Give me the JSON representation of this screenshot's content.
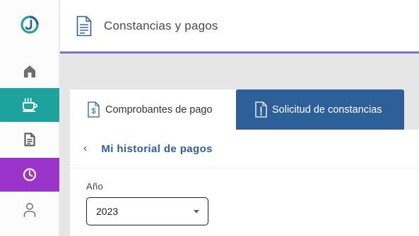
{
  "app": {
    "logo_icon": "app-logo-icon"
  },
  "colors": {
    "teal": "#1ba39c",
    "purple": "#9b35c9",
    "blue": "#2e5f99",
    "header_underline": "#7b6fd9"
  },
  "sidebar": {
    "items": [
      {
        "name": "home",
        "icon": "home-icon",
        "active": false
      },
      {
        "name": "coffee",
        "icon": "coffee-icon",
        "active": false,
        "highlight": "#1ba39c"
      },
      {
        "name": "documents",
        "icon": "document-icon",
        "active": false
      },
      {
        "name": "history",
        "icon": "clock-icon",
        "active": true,
        "highlight": "#9b35c9"
      },
      {
        "name": "profile",
        "icon": "user-icon",
        "active": false
      }
    ]
  },
  "header": {
    "title": "Constancias y pagos",
    "icon": "document-icon"
  },
  "tabs": [
    {
      "label": "Comprobantes de pago",
      "icon": "receipt-dollar-icon",
      "active": false
    },
    {
      "label": "Solicitud de constancias",
      "icon": "certificate-icon",
      "active": true
    }
  ],
  "panel": {
    "back_label": "‹",
    "title": "Mi historial de pagos",
    "year_label": "Año",
    "year_value": "2023"
  }
}
